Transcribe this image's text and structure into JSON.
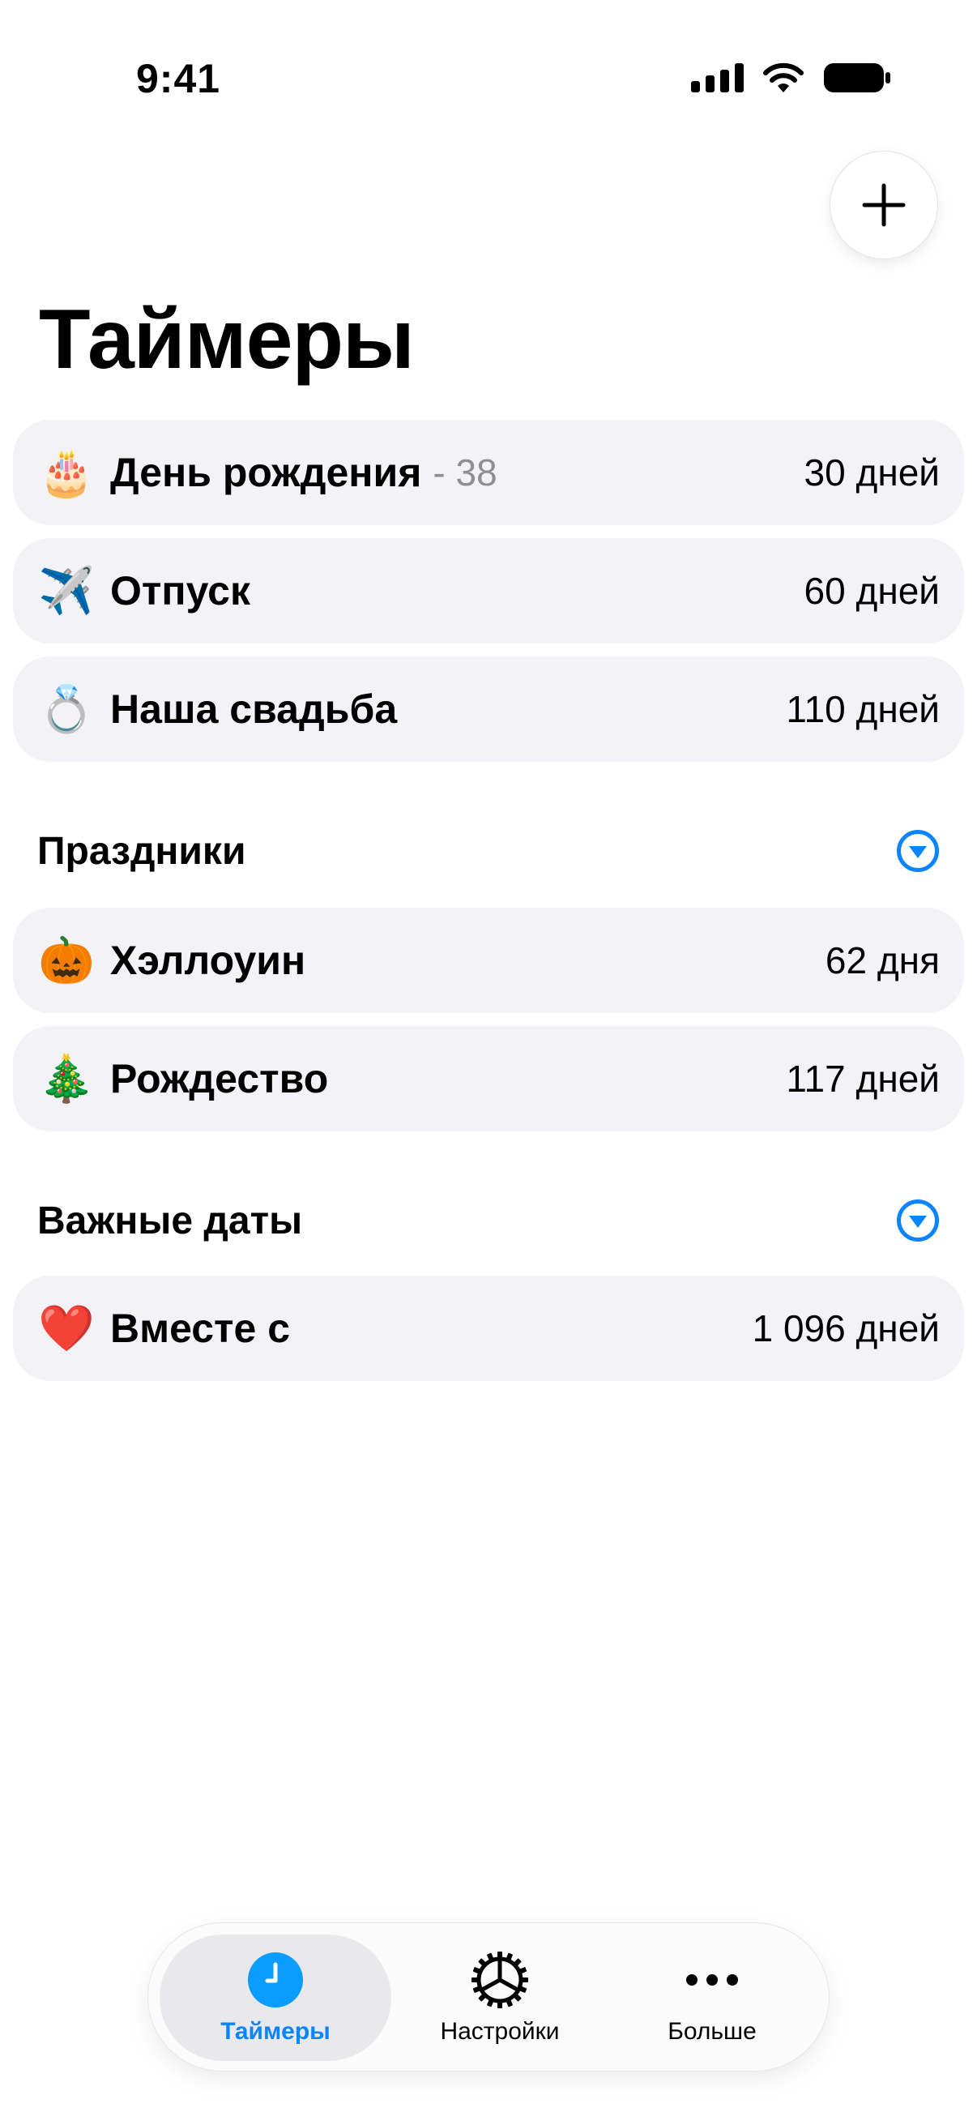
{
  "status": {
    "time": "9:41"
  },
  "header": {
    "title": "Таймеры",
    "add_icon": "plus-icon"
  },
  "timers": [
    {
      "emoji": "🎂",
      "title": "День рождения",
      "age": "- 38",
      "value": "30 дней"
    },
    {
      "emoji": "✈️",
      "title": "Отпуск",
      "value": "60 дней"
    },
    {
      "emoji": "💍",
      "title": "Наша свадьба",
      "value": "110 дней"
    }
  ],
  "holidays": {
    "label": "Праздники",
    "items": [
      {
        "emoji": "🎃",
        "title": "Хэллоуин",
        "value": "62 дня"
      },
      {
        "emoji": "🎄",
        "title": "Рождество",
        "value": "117 дней"
      }
    ]
  },
  "important": {
    "label": "Важные даты",
    "items": [
      {
        "emoji": "❤️",
        "title": "Вместе с",
        "value": "1 096 дней"
      }
    ]
  },
  "tabs": [
    {
      "label": "Таймеры",
      "icon": "clock-icon",
      "active": true
    },
    {
      "label": "Настройки",
      "icon": "gear-icon"
    },
    {
      "label": "Больше",
      "icon": "more-icon"
    }
  ],
  "colors": {
    "accent": "#0a84ff",
    "row_bg": "#f2f2f7",
    "secondary_text": "#8e8e93"
  }
}
